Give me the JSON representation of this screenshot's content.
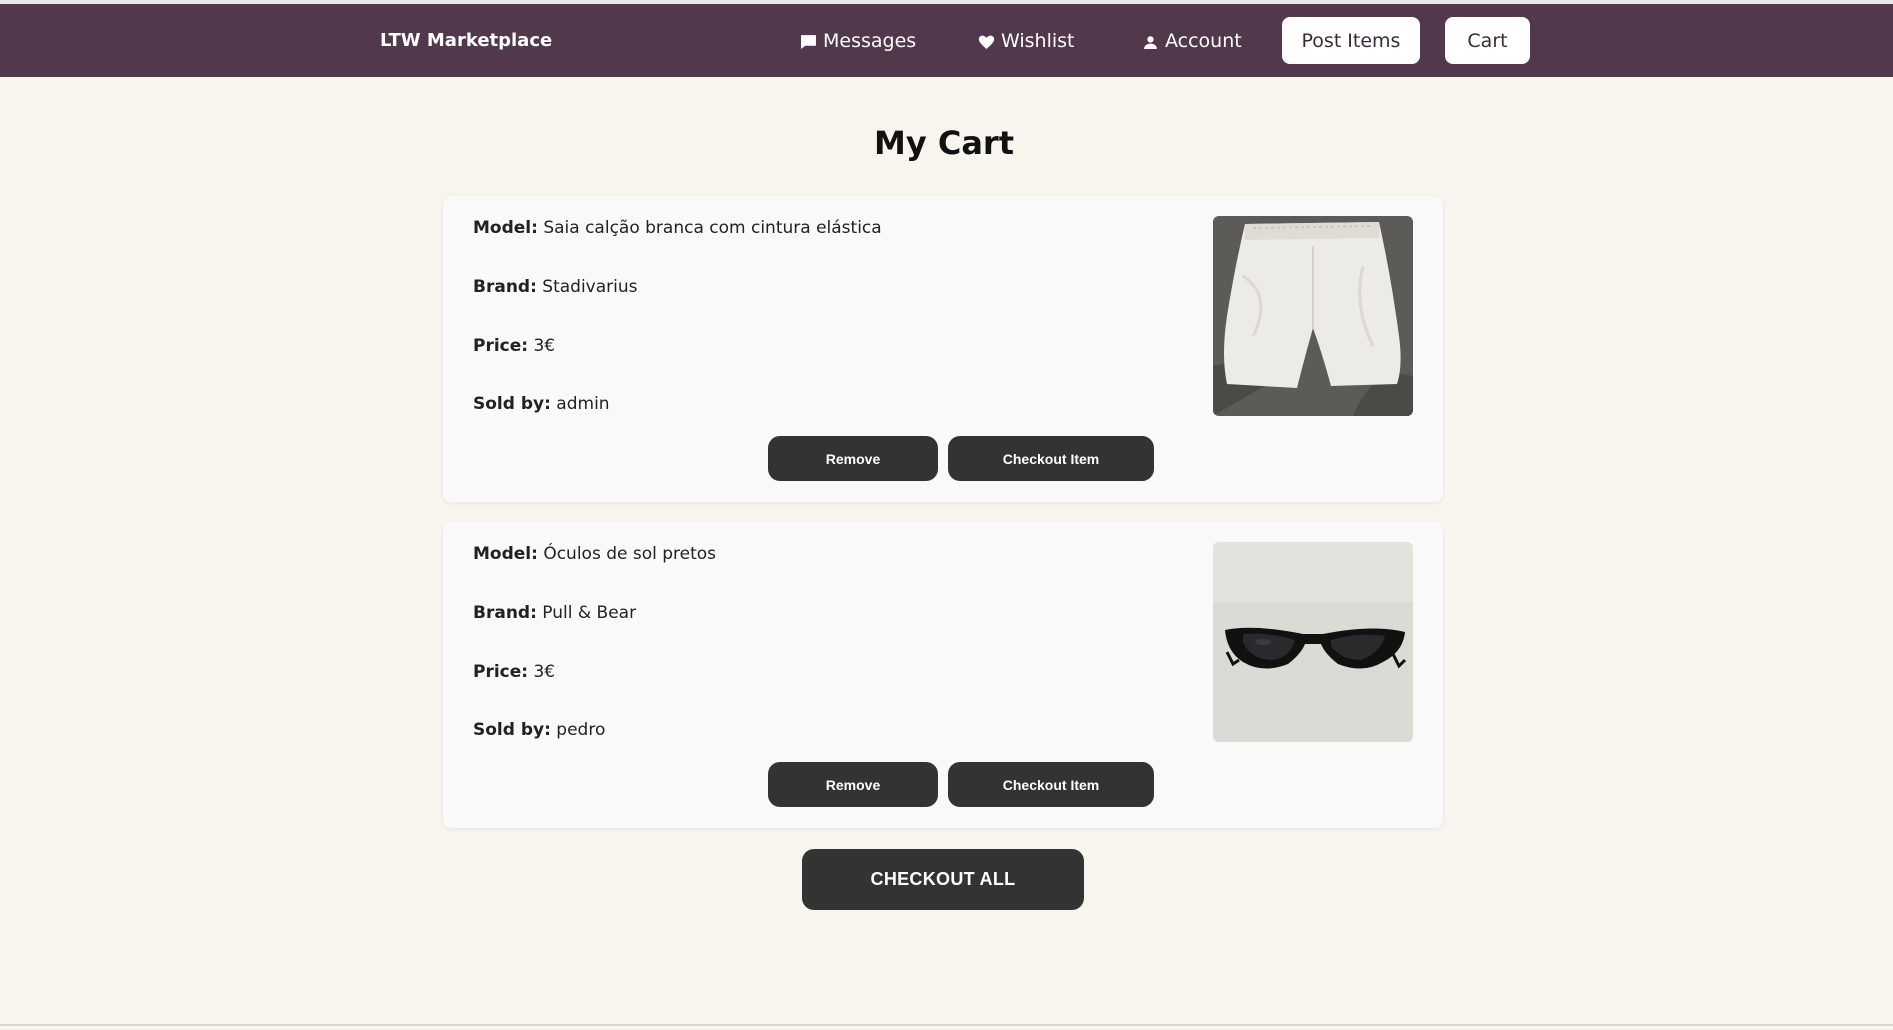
{
  "navbar": {
    "brand": "LTW Marketplace",
    "links": [
      {
        "label": "Messages",
        "icon": "chat-bubble-icon"
      },
      {
        "label": "Wishlist",
        "icon": "heart-icon"
      },
      {
        "label": "Account",
        "icon": "user-icon"
      }
    ],
    "post_items_label": "Post Items",
    "cart_label": "Cart"
  },
  "page": {
    "title": "My Cart"
  },
  "labels": {
    "model": "Model:",
    "brand": "Brand:",
    "price": "Price:",
    "sold_by": "Sold by:",
    "remove": "Remove",
    "checkout_item": "Checkout Item"
  },
  "cart_items": [
    {
      "model": "Saia calção branca com cintura elástica",
      "brand": "Stadivarius",
      "price": "3€",
      "seller": "admin",
      "image": "white-shorts"
    },
    {
      "model": "Óculos de sol pretos",
      "brand": "Pull & Bear",
      "price": "3€",
      "seller": "pedro",
      "image": "black-sunglasses"
    }
  ],
  "checkout_all_label": "CHECKOUT ALL",
  "colors": {
    "navbar": "#51384d",
    "background": "#f8f5ef",
    "button_dark": "#333333"
  }
}
